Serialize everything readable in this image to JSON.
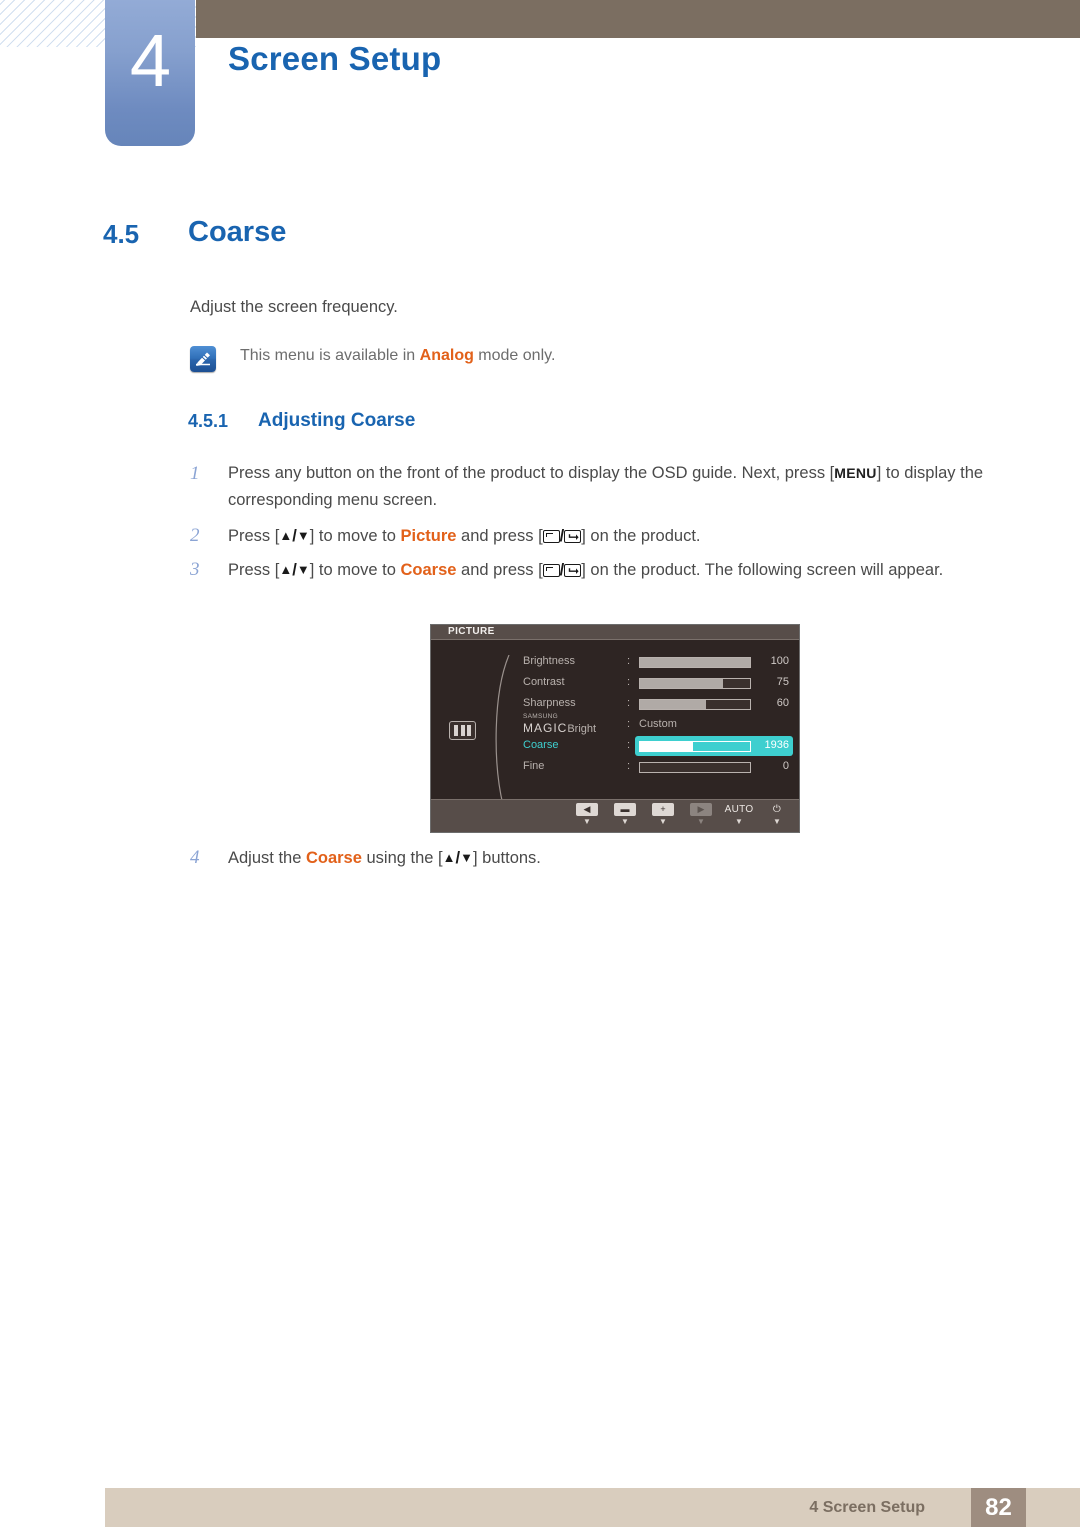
{
  "chapter": {
    "number": "4",
    "title": "Screen Setup"
  },
  "section": {
    "number": "4.5",
    "title": "Coarse",
    "intro": "Adjust the screen frequency."
  },
  "note": {
    "icon": "note-pencil-icon",
    "text_before": "This menu is available in ",
    "highlight": "Analog",
    "text_after": " mode only."
  },
  "subsection": {
    "number": "4.5.1",
    "title": "Adjusting Coarse"
  },
  "steps": [
    {
      "number": "1",
      "pre": "Press any button on the front of the product to display the OSD guide. Next, press [",
      "key": "MENU",
      "post": "] to display the corresponding menu screen."
    },
    {
      "number": "2",
      "p1": "Press [",
      "p2": "] to move to ",
      "target": "Picture",
      "p3": " and press [",
      "p4": "] on the product."
    },
    {
      "number": "3",
      "p1": "Press [",
      "p2": "] to move to ",
      "target": "Coarse",
      "p3": " and press [",
      "p4": "] on the product. The following screen will appear."
    },
    {
      "number": "4",
      "p1": "Adjust the ",
      "target": "Coarse",
      "p2": " using the [",
      "p3": "] buttons."
    }
  ],
  "osd": {
    "title": "PICTURE",
    "side_icon": "picture-bars-icon",
    "rows": [
      {
        "label": "Brightness",
        "colon": ":",
        "value": "100",
        "fill": 100,
        "type": "bar",
        "selected": false
      },
      {
        "label": "Contrast",
        "colon": ":",
        "value": "75",
        "fill": 75,
        "type": "bar",
        "selected": false
      },
      {
        "label": "Sharpness",
        "colon": ":",
        "value": "60",
        "fill": 60,
        "type": "bar",
        "selected": false
      },
      {
        "label_small": "SAMSUNG",
        "label_large": "MAGIC",
        "label_suffix": "Bright",
        "colon": ":",
        "value": "Custom",
        "type": "text",
        "selected": false
      },
      {
        "label": "Coarse",
        "colon": ":",
        "value": "1936",
        "fill": 48,
        "type": "bar",
        "selected": true
      },
      {
        "label": "Fine",
        "colon": ":",
        "value": "0",
        "fill": 0,
        "type": "bar",
        "selected": false
      }
    ],
    "buttons": [
      {
        "name": "left-arrow-button",
        "glyph": "◀",
        "hint": "▼",
        "style": "cap"
      },
      {
        "name": "minus-button",
        "glyph": "▬",
        "hint": "▼",
        "style": "cap"
      },
      {
        "name": "plus-button",
        "glyph": "+",
        "hint": "▼",
        "style": "cap"
      },
      {
        "name": "right-arrow-button",
        "glyph": "▶",
        "hint": "▼",
        "style": "dim"
      },
      {
        "name": "auto-button",
        "glyph": "AUTO",
        "hint": "▼",
        "style": "bare"
      },
      {
        "name": "power-button",
        "glyph": "⏻",
        "hint": "▼",
        "style": "bare"
      }
    ]
  },
  "footer": {
    "label": "4 Screen Setup",
    "page": "82"
  },
  "colors": {
    "brand_blue": "#1964b0",
    "accent_orange": "#e2611a",
    "header_brown": "#7b6e61",
    "footer_beige": "#d9cdbe",
    "page_box_brown": "#9e8d80",
    "osd_highlight": "#3ecfcf",
    "tab_blue": "#6e8bc0"
  }
}
